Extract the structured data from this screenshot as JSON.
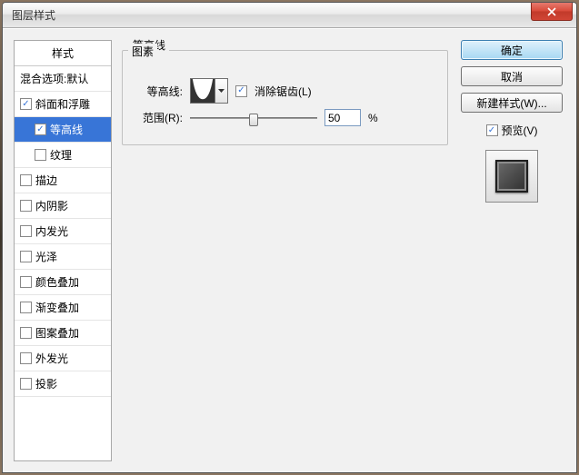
{
  "window": {
    "title": "图层样式"
  },
  "styles": {
    "header": "样式",
    "blend": "混合选项:默认",
    "bevel": "斜面和浮雕",
    "contour": "等高线",
    "texture": "纹理",
    "stroke": "描边",
    "innerShadow": "内阴影",
    "innerGlow": "内发光",
    "satin": "光泽",
    "colorOverlay": "颜色叠加",
    "gradientOverlay": "渐变叠加",
    "patternOverlay": "图案叠加",
    "outerGlow": "外发光",
    "dropShadow": "投影"
  },
  "panel": {
    "title": "等高线",
    "elements": "图素",
    "contourLabel": "等高线:",
    "antiAlias": "消除锯齿(L)",
    "rangeLabel": "范围(R):",
    "rangeValue": "50",
    "percent": "%"
  },
  "buttons": {
    "ok": "确定",
    "cancel": "取消",
    "newStyle": "新建样式(W)...",
    "preview": "预览(V)"
  }
}
